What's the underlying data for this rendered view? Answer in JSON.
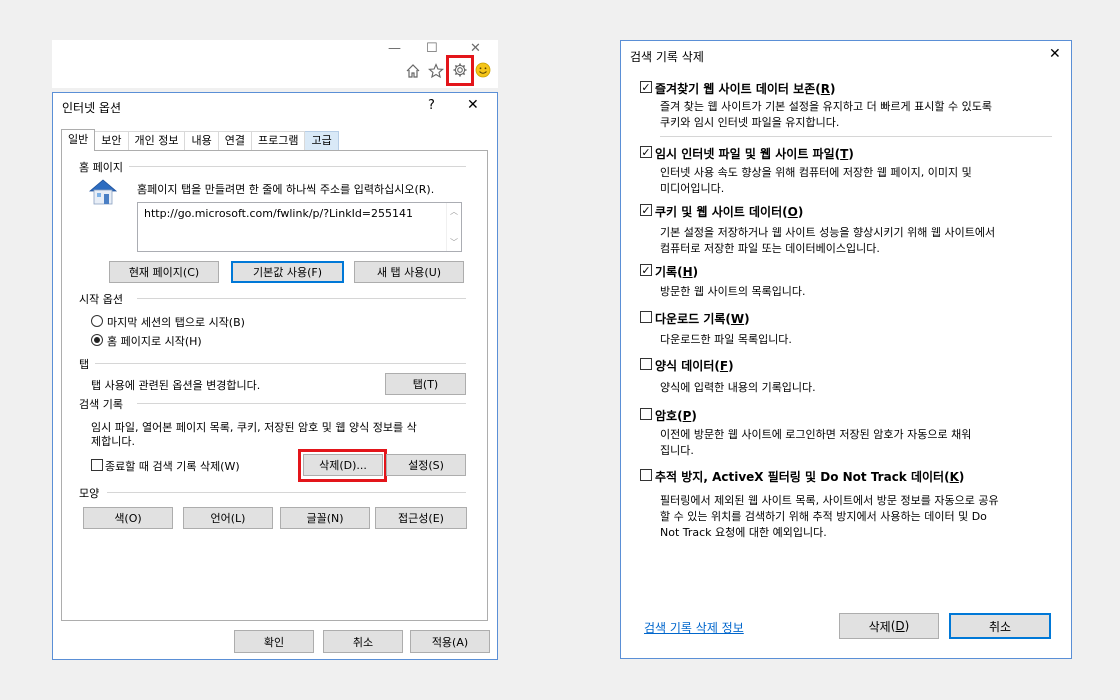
{
  "browser": {
    "controls": {
      "minimize": "—",
      "maximize": "☐",
      "close": "✕"
    },
    "toolbar_icons": [
      "home-icon",
      "star-icon",
      "gear-icon",
      "smiley-icon"
    ]
  },
  "internet_options": {
    "title": "인터넷 옵션",
    "help": "?",
    "close": "✕",
    "tabs": [
      {
        "label": "일반"
      },
      {
        "label": "보안"
      },
      {
        "label": "개인 정보"
      },
      {
        "label": "내용"
      },
      {
        "label": "연결"
      },
      {
        "label": "프로그램"
      },
      {
        "label": "고급"
      }
    ],
    "home_page": {
      "section": "홈 페이지",
      "instruction": "홈페이지 탭을 만들려면 한 줄에 하나씩 주소를 입력하십시오(R).",
      "url": "http://go.microsoft.com/fwlink/p/?LinkId=255141",
      "buttons": {
        "current": "현재 페이지(C)",
        "default": "기본값 사용(F)",
        "new_tab": "새 탭 사용(U)"
      }
    },
    "startup": {
      "section": "시작 옵션",
      "option1": "마지막 세션의 탭으로 시작(B)",
      "option2": "홈 페이지로 시작(H)"
    },
    "tabs_section": {
      "section": "탭",
      "desc": "탭 사용에 관련된 옵션을 변경합니다.",
      "button": "탭(T)"
    },
    "history": {
      "section": "검색 기록",
      "desc_line1": "임시 파일, 열어본 페이지 목록, 쿠키, 저장된 암호 및 웹 양식 정보를 삭",
      "desc_line2": "제합니다.",
      "checkbox": "종료할 때 검색 기록 삭제(W)",
      "delete": "삭제(D)...",
      "settings": "설정(S)"
    },
    "appearance": {
      "section": "모양",
      "buttons": [
        "색(O)",
        "언어(L)",
        "글꼴(N)",
        "접근성(E)"
      ]
    },
    "footer": {
      "ok": "확인",
      "cancel": "취소",
      "apply": "적용(A)"
    }
  },
  "delete_history": {
    "title": "검색 기록 삭제",
    "close": "✕",
    "items": [
      {
        "label": "즐겨찾기 웹 사이트 데이터 보존",
        "key": "R",
        "checked": true,
        "desc": [
          "즐겨 찾는 웹 사이트가 기본 설정을 유지하고 더 빠르게 표시할 수 있도록",
          "쿠키와 임시 인터넷 파일을 유지합니다."
        ]
      },
      {
        "label": "임시 인터넷 파일 및 웹 사이트 파일",
        "key": "T",
        "checked": true,
        "desc": [
          "인터넷 사용 속도 향상을 위해 컴퓨터에 저장한 웹 페이지, 이미지 및",
          "미디어입니다."
        ]
      },
      {
        "label": "쿠키 및 웹 사이트 데이터",
        "key": "O",
        "checked": true,
        "desc": [
          "기본 설정을 저장하거나 웹 사이트 성능을 향상시키기 위해 웹 사이트에서",
          "컴퓨터로 저장한 파일 또는 데이터베이스입니다."
        ]
      },
      {
        "label": "기록",
        "key": "H",
        "checked": true,
        "desc": [
          "방문한 웹 사이트의 목록입니다."
        ]
      },
      {
        "label": "다운로드 기록",
        "key": "W",
        "checked": false,
        "desc": [
          "다운로드한 파일 목록입니다."
        ]
      },
      {
        "label": "양식 데이터",
        "key": "F",
        "checked": false,
        "desc": [
          "양식에 입력한 내용의 기록입니다."
        ]
      },
      {
        "label": "암호",
        "key": "P",
        "checked": false,
        "desc": [
          "이전에 방문한 웹 사이트에 로그인하면 저장된 암호가 자동으로 채워",
          "집니다."
        ]
      },
      {
        "label": "추적 방지, ActiveX 필터링 및 Do Not Track 데이터",
        "key": "K",
        "checked": false,
        "desc": [
          "필터링에서 제외된 웹 사이트 목록, 사이트에서 방문 정보를 자동으로 공유",
          "할 수 있는 위치를 검색하기 위해 추적 방지에서 사용하는 데이터 및 Do",
          "Not Track 요청에 대한 예외입니다."
        ]
      }
    ],
    "info_link": "검색 기록 삭제 정보",
    "delete_label": "삭제",
    "delete_key": "D",
    "cancel": "취소"
  }
}
